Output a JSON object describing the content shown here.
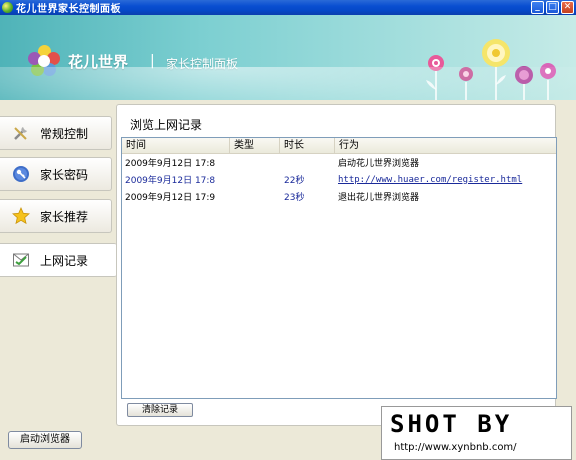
{
  "window": {
    "title": "花儿世界家长控制面板"
  },
  "banner": {
    "brand": "花儿世界",
    "separator": "|",
    "subtitle": "家长控制面板"
  },
  "nav": {
    "items": [
      {
        "label": "常规控制",
        "icon": "tools-icon"
      },
      {
        "label": "家长密码",
        "icon": "key-icon"
      },
      {
        "label": "家长推荐",
        "icon": "star-icon"
      },
      {
        "label": "上网记录",
        "icon": "log-icon",
        "active": true
      }
    ],
    "launch_button": "启动浏览器"
  },
  "main": {
    "title": "浏览上网记录",
    "columns": [
      "时间",
      "类型",
      "时长",
      "行为"
    ],
    "rows": [
      {
        "time": "2009年9月12日 17:8",
        "type": "",
        "duration": "",
        "action": "启动花儿世界浏览器"
      },
      {
        "time": "2009年9月12日 17:8",
        "type": "",
        "duration": "22秒",
        "action": "http://www.huaer.com/register.html"
      },
      {
        "time": "2009年9月12日 17:9",
        "type": "",
        "duration": "23秒",
        "action": "退出花儿世界浏览器"
      }
    ],
    "clear_button": "清除记录"
  },
  "watermark": {
    "line1": "SHOT BY",
    "line2": "http://www.xynbnb.com/"
  }
}
